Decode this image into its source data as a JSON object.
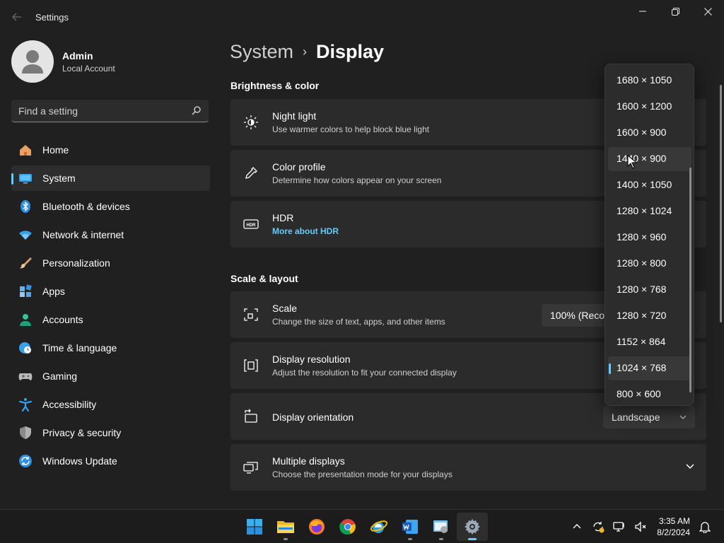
{
  "window": {
    "title": "Settings",
    "controls": [
      "minimize-icon",
      "restore-icon",
      "close-icon"
    ]
  },
  "profile": {
    "name": "Admin",
    "account_type": "Local Account"
  },
  "search": {
    "placeholder": "Find a setting"
  },
  "sidebar": {
    "items": [
      {
        "label": "Home",
        "icon": "home-icon",
        "active": false
      },
      {
        "label": "System",
        "icon": "system-icon",
        "active": true
      },
      {
        "label": "Bluetooth & devices",
        "icon": "bluetooth-icon",
        "active": false
      },
      {
        "label": "Network & internet",
        "icon": "wifi-icon",
        "active": false
      },
      {
        "label": "Personalization",
        "icon": "brush-icon",
        "active": false
      },
      {
        "label": "Apps",
        "icon": "apps-icon",
        "active": false
      },
      {
        "label": "Accounts",
        "icon": "accounts-icon",
        "active": false
      },
      {
        "label": "Time & language",
        "icon": "clock-globe-icon",
        "active": false
      },
      {
        "label": "Gaming",
        "icon": "gamepad-icon",
        "active": false
      },
      {
        "label": "Accessibility",
        "icon": "accessibility-icon",
        "active": false
      },
      {
        "label": "Privacy & security",
        "icon": "shield-icon",
        "active": false
      },
      {
        "label": "Windows Update",
        "icon": "update-icon",
        "active": false
      }
    ]
  },
  "breadcrumb": {
    "parent": "System",
    "separator": "›",
    "current": "Display"
  },
  "sections": {
    "brightness": "Brightness & color",
    "scale_layout": "Scale & layout"
  },
  "cards": {
    "night_light": {
      "title": "Night light",
      "subtitle": "Use warmer colors to help block blue light"
    },
    "color_profile": {
      "title": "Color profile",
      "subtitle": "Determine how colors appear on your screen"
    },
    "hdr": {
      "title": "HDR",
      "link": "More about HDR"
    },
    "scale": {
      "title": "Scale",
      "subtitle": "Change the size of text, apps, and other items",
      "value": "100% (Recommended)"
    },
    "resolution": {
      "title": "Display resolution",
      "subtitle": "Adjust the resolution to fit your connected display"
    },
    "orientation": {
      "title": "Display orientation",
      "value": "Landscape"
    },
    "multiple": {
      "title": "Multiple displays",
      "subtitle": "Choose the presentation mode for your displays"
    }
  },
  "resolution_dropdown": {
    "options": [
      "1680 × 1050",
      "1600 × 1200",
      "1600 × 900",
      "1440 × 900",
      "1400 × 1050",
      "1280 × 1024",
      "1280 × 960",
      "1280 × 800",
      "1280 × 768",
      "1280 × 720",
      "1152 × 864",
      "1024 × 768",
      "800 × 600"
    ],
    "selected": "1024 × 768",
    "hovered": "1440 × 900"
  },
  "taskbar": {
    "apps": [
      "start-icon",
      "file-explorer-icon",
      "firefox-icon",
      "chrome-icon",
      "internet-explorer-icon",
      "word-icon",
      "control-panel-icon",
      "settings-icon"
    ],
    "time": "3:35 AM",
    "date": "8/2/2024"
  },
  "colors": {
    "accent": "#60cdff",
    "background": "#202020",
    "card": "#2b2b2b"
  }
}
